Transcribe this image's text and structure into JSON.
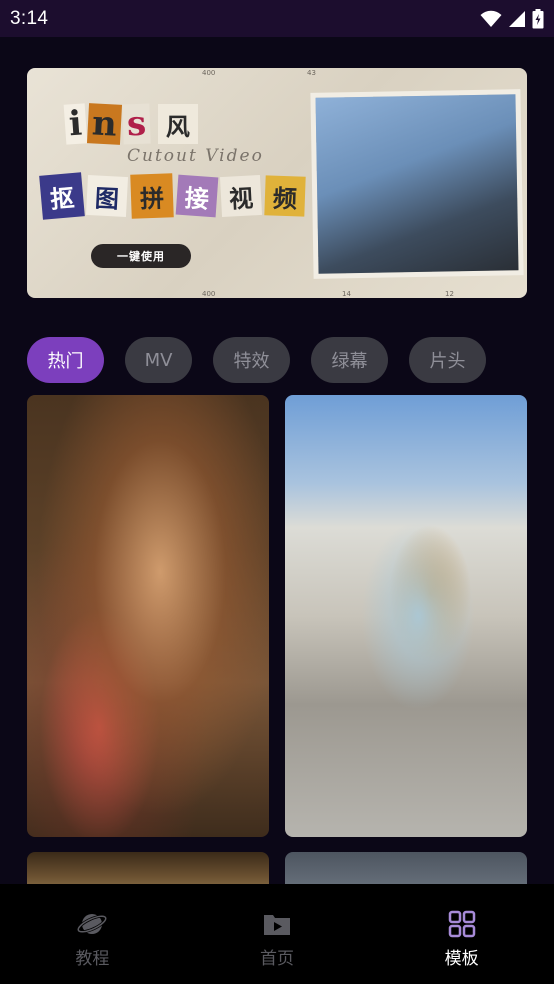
{
  "status_bar": {
    "time": "3:14",
    "icons": [
      "wifi-icon",
      "signal-icon",
      "battery-charging-icon"
    ]
  },
  "banner": {
    "title_latin": [
      "i",
      "n",
      "s"
    ],
    "title_cn_suffix": "风",
    "subtitle": "Cutout Video",
    "title_cn": [
      "抠",
      "图",
      "拼",
      "接",
      "视",
      "频"
    ],
    "button_label": "一键使用",
    "ruler_labels": [
      "400",
      "43",
      "400",
      "14",
      "12"
    ]
  },
  "tabs": [
    {
      "label": "热门",
      "active": true
    },
    {
      "label": "MV",
      "active": false
    },
    {
      "label": "特效",
      "active": false
    },
    {
      "label": "绿幕",
      "active": false
    },
    {
      "label": "片头",
      "active": false
    }
  ],
  "cards": [
    {
      "subject": "woman-with-lilies-photo"
    },
    {
      "subject": "ice-cream-cone-photo"
    },
    {
      "subject": "food-photo"
    },
    {
      "subject": "street-photo"
    }
  ],
  "bottom_nav": [
    {
      "label": "教程",
      "icon": "planet-icon",
      "active": false
    },
    {
      "label": "首页",
      "icon": "play-folder-icon",
      "active": false
    },
    {
      "label": "模板",
      "icon": "grid-icon",
      "active": true
    }
  ],
  "colors": {
    "accent": "#7c3fbd",
    "status_bar": "#1c0d2e",
    "background": "#0b0717",
    "tab_inactive": "#3a3a42",
    "nav_bg": "#000000"
  }
}
